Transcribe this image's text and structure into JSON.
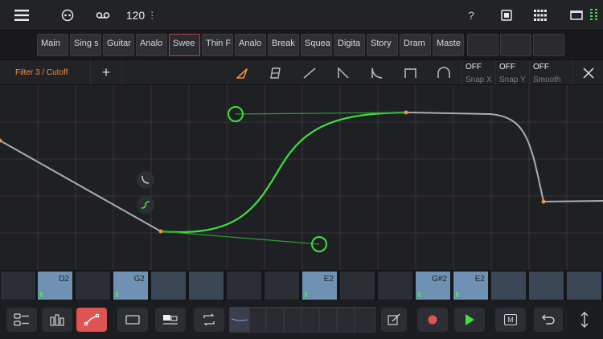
{
  "header": {
    "bpm": "120",
    "bpm_menu": "⋮",
    "help": "?"
  },
  "patterns": [
    {
      "label": "Main",
      "selected": false
    },
    {
      "label": "Sing s",
      "selected": false
    },
    {
      "label": "Guitar",
      "selected": false
    },
    {
      "label": "Analo",
      "selected": false
    },
    {
      "label": "Swee",
      "selected": true
    },
    {
      "label": "Thin F",
      "selected": false
    },
    {
      "label": "Analo",
      "selected": false
    },
    {
      "label": "Break",
      "selected": false
    },
    {
      "label": "Squea",
      "selected": false
    },
    {
      "label": "Digita",
      "selected": false
    },
    {
      "label": "Story",
      "selected": false
    },
    {
      "label": "Dram",
      "selected": false
    },
    {
      "label": "Maste",
      "selected": false
    },
    {
      "label": "",
      "selected": false
    },
    {
      "label": "",
      "selected": false
    },
    {
      "label": "",
      "selected": false
    }
  ],
  "editor": {
    "parameter": "Filter 3 / Cutoff",
    "add": "+",
    "snap_x": {
      "value": "OFF",
      "label": "Snap X"
    },
    "snap_y": {
      "value": "OFF",
      "label": "Snap Y"
    },
    "smooth": {
      "value": "OFF",
      "label": "Smooth"
    },
    "tools": [
      "pen-tool-icon",
      "eraser-icon",
      "line-icon",
      "ramp-down-icon",
      "exp-down-icon",
      "square-icon",
      "arc-icon"
    ]
  },
  "colors": {
    "accent_orange": "#f0913a",
    "curve_green": "#3fe13a",
    "record_red": "#e05353",
    "note_blue": "#6f91b3"
  },
  "steps": [
    {
      "note": "",
      "state": "off"
    },
    {
      "note": "D2",
      "state": "note"
    },
    {
      "note": "",
      "state": "off"
    },
    {
      "note": "G2",
      "state": "note"
    },
    {
      "note": "",
      "state": "mid"
    },
    {
      "note": "",
      "state": "mid"
    },
    {
      "note": "",
      "state": "off"
    },
    {
      "note": "",
      "state": "off"
    },
    {
      "note": "E2",
      "state": "note"
    },
    {
      "note": "",
      "state": "off"
    },
    {
      "note": "",
      "state": "off"
    },
    {
      "note": "G#2",
      "state": "note"
    },
    {
      "note": "E2",
      "state": "note"
    },
    {
      "note": "",
      "state": "mid"
    },
    {
      "note": "",
      "state": "mid"
    },
    {
      "note": "",
      "state": "mid"
    }
  ],
  "transport": {
    "mute_label": "M"
  }
}
